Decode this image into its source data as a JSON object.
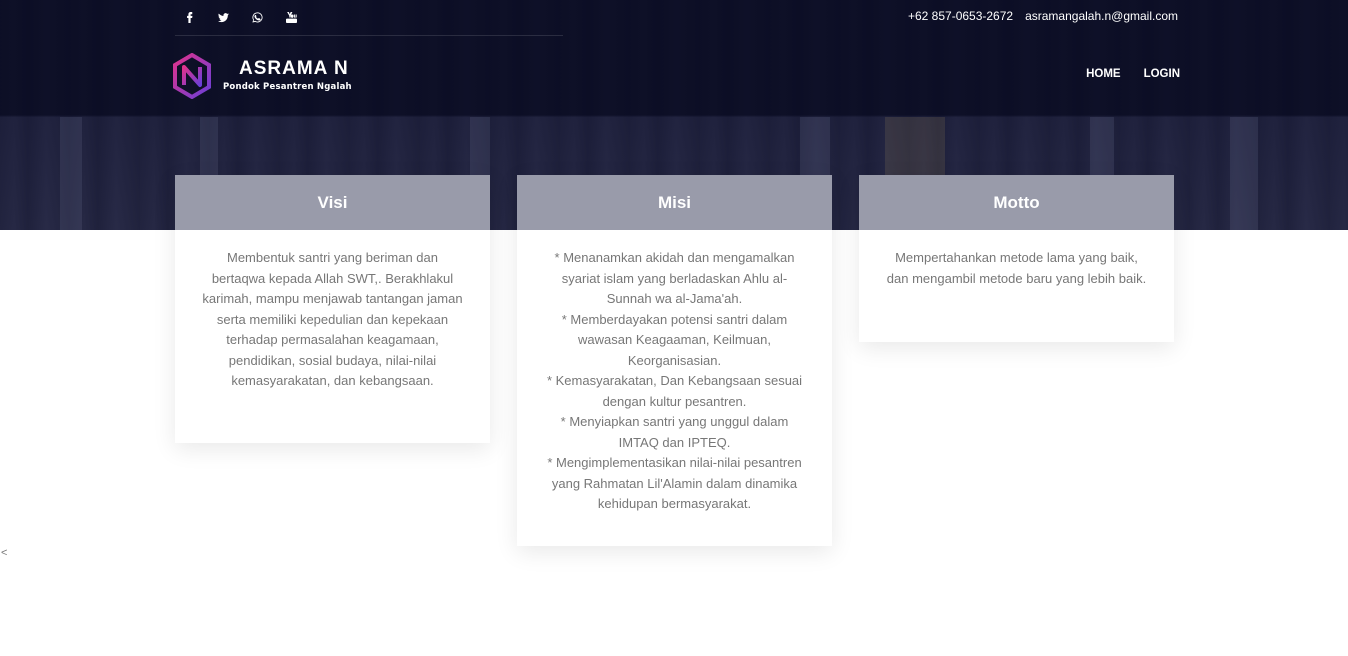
{
  "topbar": {
    "social": [
      {
        "icon": "facebook-icon",
        "glyph": "f"
      },
      {
        "icon": "twitter-icon",
        "glyph": "t"
      },
      {
        "icon": "whatsapp-icon",
        "glyph": "w"
      },
      {
        "icon": "youtube-icon",
        "glyph": "y"
      }
    ],
    "phone": "+62 857-0653-2672",
    "email": "asramangalah.n@gmail.com"
  },
  "brand": {
    "logo_icon": "asrama-n-logo",
    "name": "ASRAMA N",
    "tagline": "Pondok Pesantren Ngalah"
  },
  "nav": {
    "home": "HOME",
    "login": "LOGIN"
  },
  "cards": {
    "visi": {
      "title": "Visi",
      "text": "Membentuk santri yang beriman dan bertaqwa kepada Allah SWT,. Berakhlakul karimah, mampu menjawab tantangan jaman serta memiliki kepedulian dan kepekaan terhadap permasalahan keagamaan, pendidikan, sosial budaya, nilai-nilai kemasyarakatan, dan kebangsaan."
    },
    "misi": {
      "title": "Misi",
      "lines": [
        "* Menanamkan akidah dan mengamalkan syariat islam yang berladaskan Ahlu al-Sunnah wa al-Jama'ah.",
        "* Memberdayakan potensi santri dalam wawasan Keagaaman, Keilmuan, Keorganisasian.",
        "* Kemasyarakatan, Dan Kebangsaan sesuai dengan kultur pesantren.",
        "* Menyiapkan santri yang unggul dalam IMTAQ dan IPTEQ.",
        "* Mengimplementasikan nilai-nilai pesantren yang Rahmatan Lil'Alamin dalam dinamika kehidupan bermasyarakat."
      ]
    },
    "motto": {
      "title": "Motto",
      "text": "Mempertahankan metode lama yang baik, dan mengambil metode baru yang lebih baik."
    }
  },
  "carousel": {
    "prev_glyph": "<"
  },
  "colors": {
    "header_bg": "#0a0c23",
    "logo_gradient_start": "#e0328c",
    "logo_gradient_end": "#6a3fd8"
  }
}
